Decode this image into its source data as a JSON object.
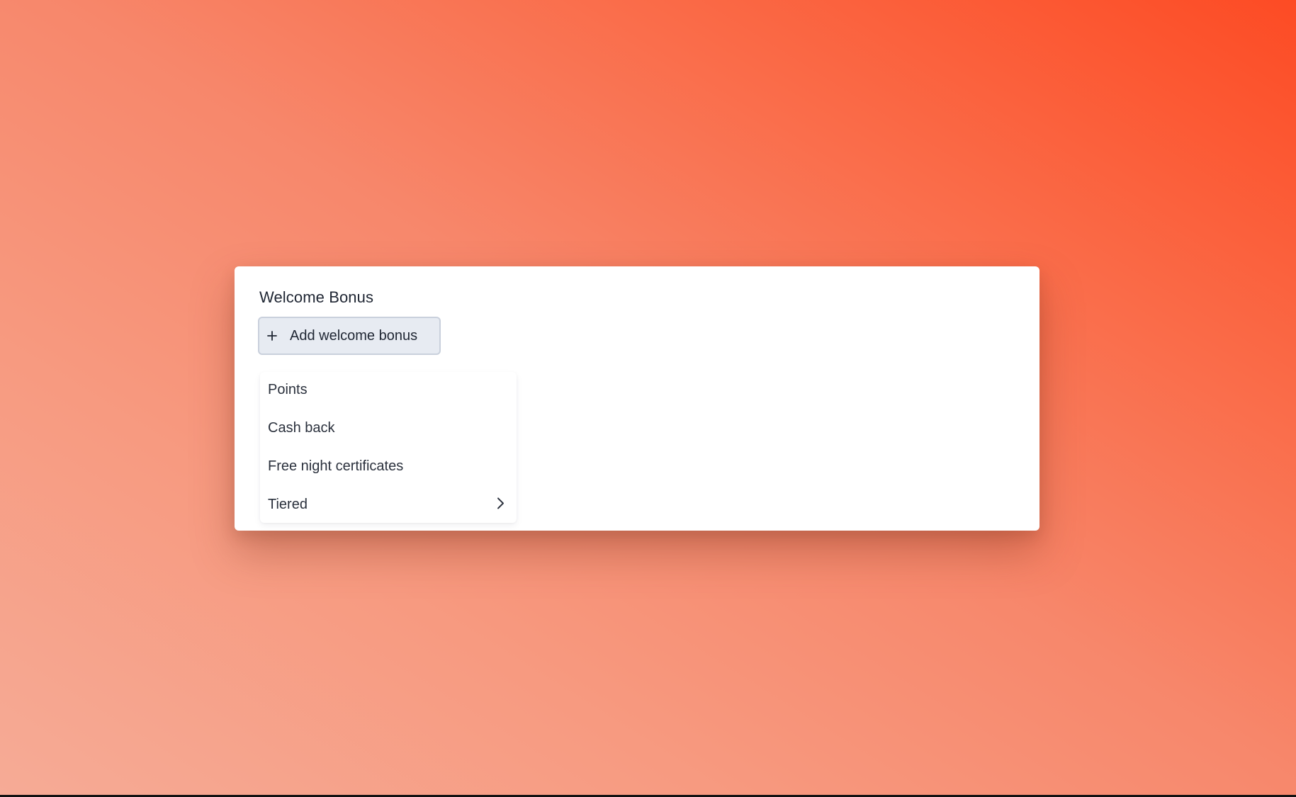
{
  "card": {
    "title": "Welcome Bonus",
    "add_button_label": "Add welcome bonus",
    "add_button_icon": "plus-icon"
  },
  "menu": {
    "items": [
      {
        "label": "Points",
        "has_submenu": false
      },
      {
        "label": "Cash back",
        "has_submenu": false
      },
      {
        "label": "Free night certificates",
        "has_submenu": false
      },
      {
        "label": "Tiered",
        "has_submenu": true,
        "icon": "chevron-right-icon"
      }
    ]
  },
  "colors": {
    "background_gradient": [
      "#fd4b24",
      "#f6ab96"
    ],
    "card_background": "#ffffff",
    "button_background": "#e7ebf2",
    "button_border": "#c9d0dc",
    "text_primary": "#1f2633"
  }
}
